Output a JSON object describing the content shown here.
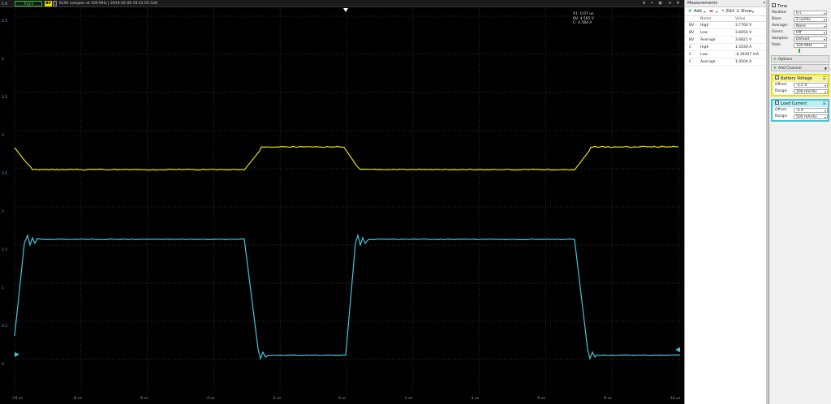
{
  "topbar": {
    "channel_label": "C A",
    "trigger": "Trig'd",
    "bv_badge": "BV",
    "c_badge": "C",
    "status": "8192 samples at 100 MHz  |  2019-02-08 19:21:55.528"
  },
  "cursor_readout": {
    "line1": "X1: 0.07 us",
    "line2": "BV: 4.565 V",
    "line3": "C: 4.584 A"
  },
  "y_ticks": [
    "4.5",
    "4",
    "3.5",
    "3",
    "2.5",
    "2",
    "1.5",
    "1",
    "0.5",
    "0"
  ],
  "x_ticks": [
    "-10 us",
    "-8 us",
    "-6 us",
    "-4 us",
    "-2 us",
    "0 us",
    "2 us",
    "4 us",
    "6 us",
    "8 us",
    "10 us"
  ],
  "measurements": {
    "title": "Measurements",
    "toolbar": {
      "add": "Add",
      "edit": "Edit",
      "show": "Show"
    },
    "columns": {
      "name": "Name",
      "value": "Value"
    },
    "rows": [
      {
        "ch": "BV",
        "name": "High",
        "value": "3.7760 V"
      },
      {
        "ch": "BV",
        "name": "Low",
        "value": "3.6054 V"
      },
      {
        "ch": "BV",
        "name": "Average",
        "value": "3.6821 V"
      },
      {
        "ch": "C",
        "name": "High",
        "value": "1.5030 A"
      },
      {
        "ch": "C",
        "name": "Low",
        "value": "-6.39307 mA"
      },
      {
        "ch": "C",
        "name": "Average",
        "value": "1.0504 A"
      }
    ]
  },
  "settings": {
    "time": {
      "title": "Time",
      "position_label": "Position:",
      "position": "0 s",
      "base_label": "Base:",
      "base": "2 us/div",
      "average_label": "Average:",
      "average": "None",
      "oversampling_label": "Overs:",
      "oversampling": "Off",
      "samples_label": "Samples:",
      "samples": "Default",
      "rate_label": "Rate:",
      "rate": "100 MHz"
    },
    "options": "Options",
    "add_channel": "Add Channel",
    "ch_bv": {
      "title": "Battery Voltage",
      "offset_label": "Offset:",
      "offset": "-3.5 V",
      "range_label": "Range:",
      "range": "200 mV/div"
    },
    "ch_c": {
      "title": "Load Current",
      "offset_label": "Offset:",
      "offset": "-2 A",
      "range_label": "Range:",
      "range": "500 mA/div"
    }
  },
  "colors": {
    "bv_trace": "#e8e000",
    "c_trace": "#40c8d8",
    "grid": "#2e2e2e"
  }
}
